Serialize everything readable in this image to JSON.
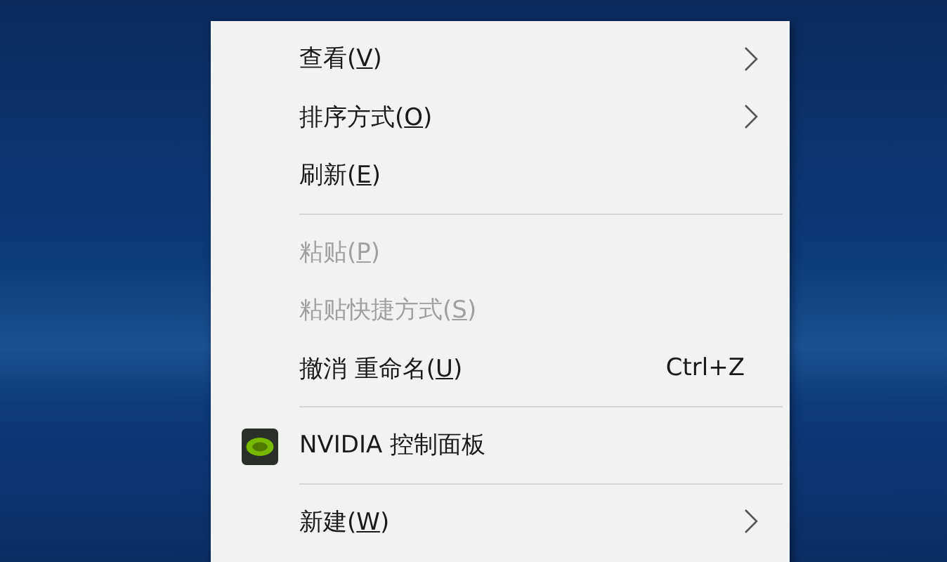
{
  "context_menu": {
    "items": [
      {
        "kind": "item",
        "text": "查看(",
        "access_key": "V",
        "text_after": ")",
        "disabled": false,
        "submenu": true
      },
      {
        "kind": "item",
        "text": "排序方式(",
        "access_key": "O",
        "text_after": ")",
        "disabled": false,
        "submenu": true
      },
      {
        "kind": "item",
        "text": "刷新(",
        "access_key": "E",
        "text_after": ")",
        "disabled": false,
        "submenu": false
      },
      {
        "kind": "separator"
      },
      {
        "kind": "item",
        "text": "粘贴(",
        "access_key": "P",
        "text_after": ")",
        "disabled": true,
        "submenu": false
      },
      {
        "kind": "item",
        "text": "粘贴快捷方式(",
        "access_key": "S",
        "text_after": ")",
        "disabled": true,
        "submenu": false
      },
      {
        "kind": "item",
        "text": "撤消 重命名(",
        "access_key": "U",
        "text_after": ")",
        "shortcut": "Ctrl+Z",
        "disabled": false,
        "submenu": false
      },
      {
        "kind": "separator"
      },
      {
        "kind": "item",
        "text": "NVIDIA 控制面板",
        "disabled": false,
        "submenu": false,
        "icon": true
      },
      {
        "kind": "separator"
      },
      {
        "kind": "item",
        "text": "新建(",
        "access_key": "W",
        "text_after": ")",
        "disabled": false,
        "submenu": true
      }
    ]
  }
}
